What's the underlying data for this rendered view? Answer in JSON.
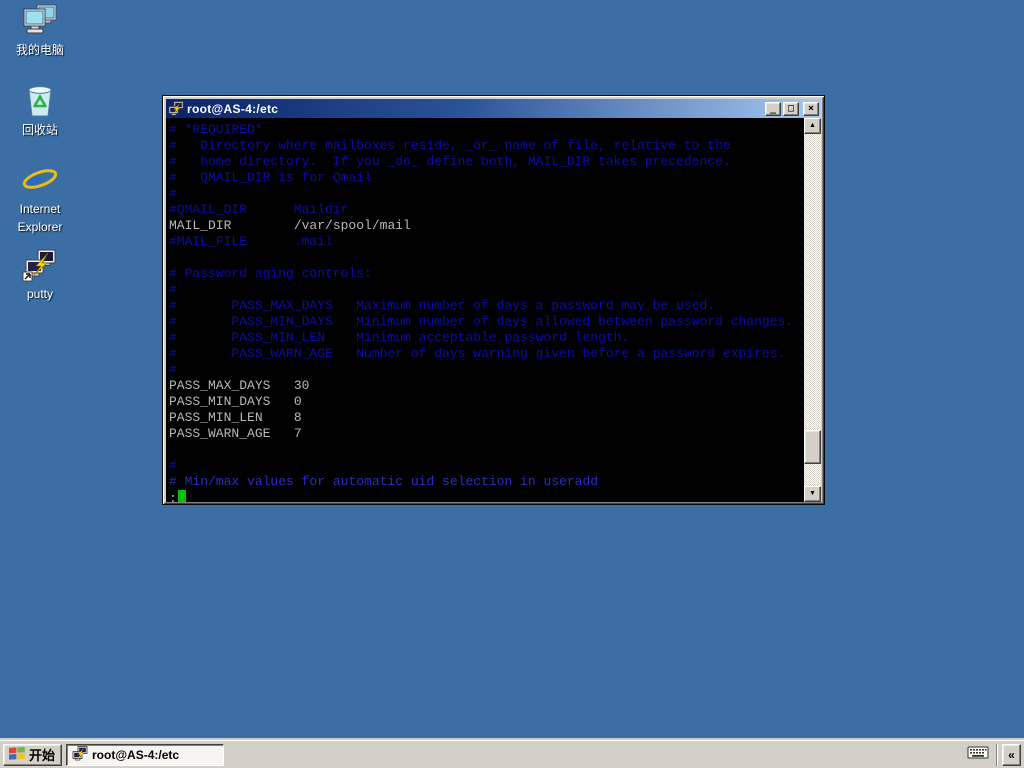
{
  "desktop": {
    "background_color": "#3A6EA5",
    "icons": [
      {
        "label": "我的电脑"
      },
      {
        "label": "回收站"
      },
      {
        "label": "Internet Explorer"
      },
      {
        "label": "putty"
      }
    ]
  },
  "window": {
    "title": "root@AS-4:/etc",
    "controls": {
      "minimize": "_",
      "maximize": "□",
      "close": "×"
    },
    "titlebar_gradient": {
      "start": "#0A246A",
      "end": "#A6CAF0"
    }
  },
  "terminal": {
    "colors": {
      "background": "#000000",
      "comment": "#0B0BA8",
      "comment_bright": "#2B2BC8",
      "text": "#B9B9B9",
      "cursor": "#00C400"
    },
    "lines": [
      {
        "t": "# *REQUIRED*",
        "c": "b"
      },
      {
        "t": "#   Directory where mailboxes reside, _or_ name of file, relative to the",
        "c": "b"
      },
      {
        "t": "#   home directory.  If you _do_ define both, MAIL_DIR takes precedence.",
        "c": "b"
      },
      {
        "t": "#   QMAIL_DIR is for Qmail",
        "c": "b"
      },
      {
        "t": "#",
        "c": "b"
      },
      {
        "t": "#QMAIL_DIR\tMaildir",
        "c": "b"
      },
      {
        "t": "MAIL_DIR\t/var/spool/mail",
        "c": "w"
      },
      {
        "t": "#MAIL_FILE\t.mail",
        "c": "b"
      },
      {
        "t": "",
        "c": "b"
      },
      {
        "t": "# Password aging controls:",
        "c": "b"
      },
      {
        "t": "#",
        "c": "b"
      },
      {
        "t": "#\tPASS_MAX_DAYS\tMaximum number of days a password may be used.",
        "c": "b"
      },
      {
        "t": "#\tPASS_MIN_DAYS\tMinimum number of days allowed between password changes.",
        "c": "b"
      },
      {
        "t": "#\tPASS_MIN_LEN\tMinimum acceptable password length.",
        "c": "b"
      },
      {
        "t": "#\tPASS_WARN_AGE\tNumber of days warning given before a password expires.",
        "c": "b"
      },
      {
        "t": "#",
        "c": "b"
      },
      {
        "t": "PASS_MAX_DAYS\t30",
        "c": "w"
      },
      {
        "t": "PASS_MIN_DAYS\t0",
        "c": "w"
      },
      {
        "t": "PASS_MIN_LEN\t8",
        "c": "w"
      },
      {
        "t": "PASS_WARN_AGE\t7",
        "c": "w"
      },
      {
        "t": "",
        "c": "w"
      },
      {
        "t": "#",
        "c": "b"
      },
      {
        "t": "# Min/max values for automatic uid selection in useradd",
        "c": "bb"
      }
    ],
    "prompt": ":"
  },
  "scrollbar": {
    "up_glyph": "▲",
    "down_glyph": "▼"
  },
  "taskbar": {
    "start_label": "开始",
    "task_label": "root@AS-4:/etc",
    "tray_collapse_glyph": "«"
  }
}
